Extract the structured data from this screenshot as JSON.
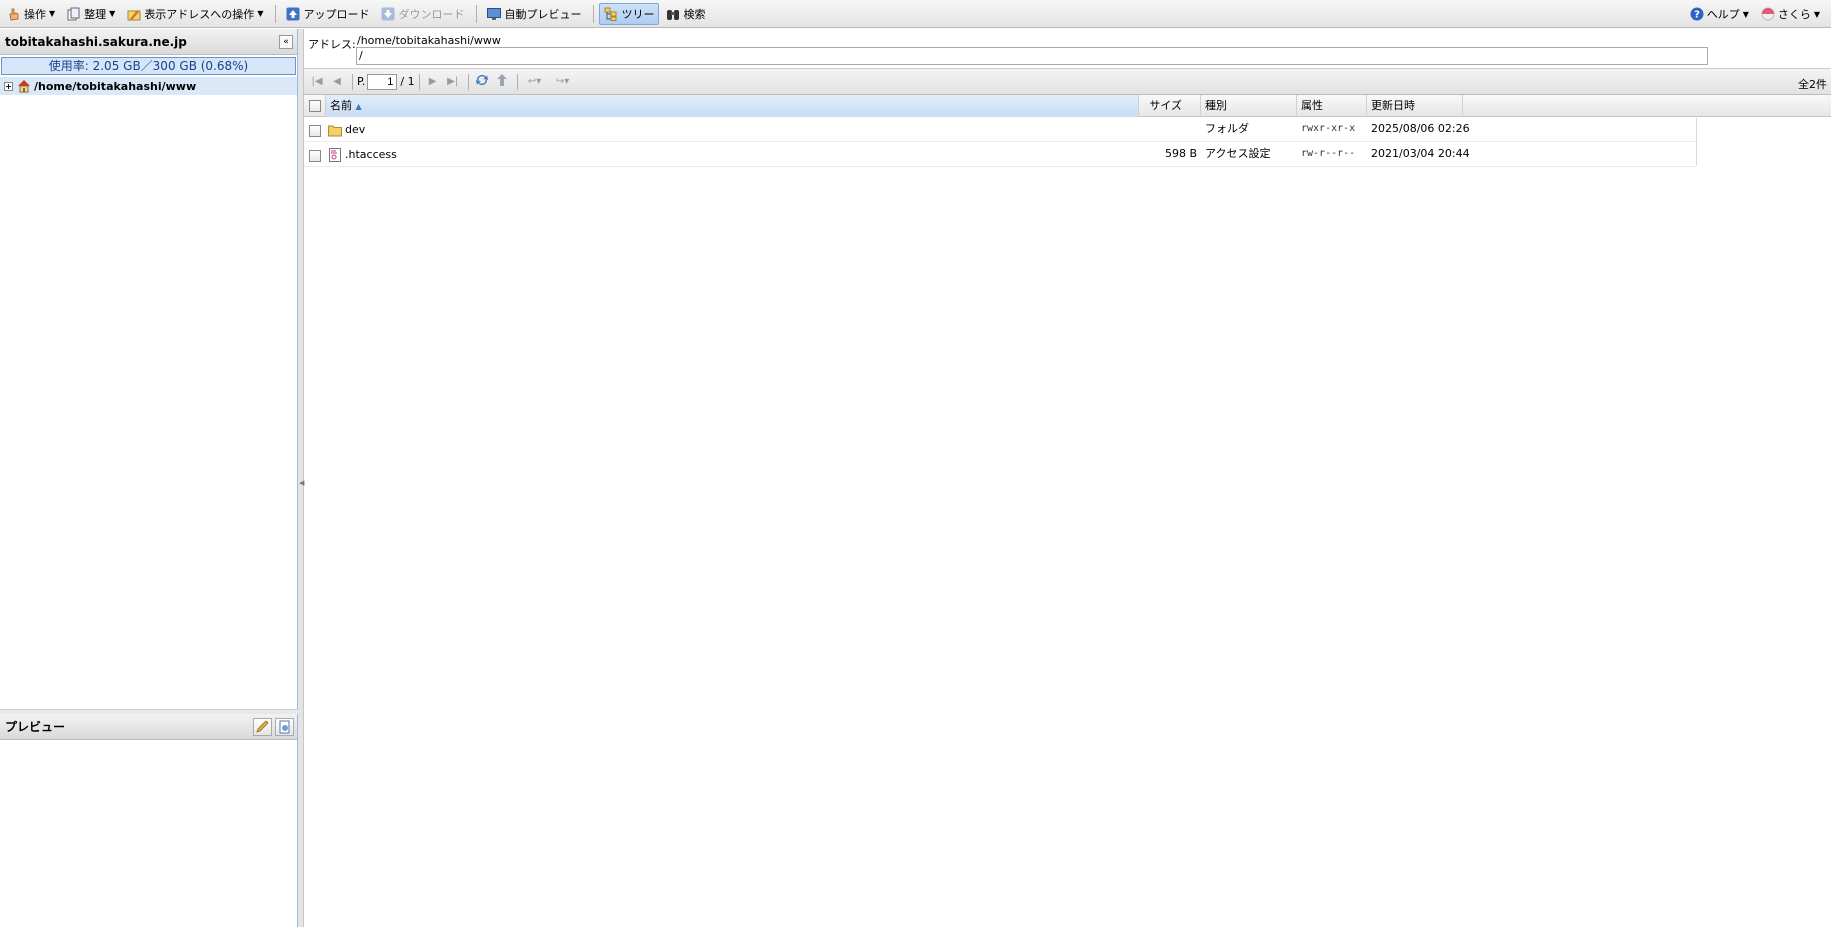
{
  "toolbar": {
    "operation": "操作",
    "organize": "整理",
    "address_ops": "表示アドレスへの操作",
    "upload": "アップロード",
    "download": "ダウンロード",
    "auto_preview": "自動プレビュー",
    "tree": "ツリー",
    "search": "検索",
    "help": "ヘルプ",
    "user": "さくら"
  },
  "left": {
    "domain": "tobitakahashi.sakura.ne.jp",
    "usage": "使用率: 2.05 GB／300 GB (0.68%)",
    "tree_root": "/home/tobitakahashi/www"
  },
  "preview": {
    "title": "プレビュー"
  },
  "address": {
    "label": "アドレス:",
    "path": "/home/tobitakahashi/www",
    "input_value": "/"
  },
  "pager": {
    "page_prefix": "P.",
    "page": "1",
    "page_total": "/ 1",
    "total": "全2件"
  },
  "grid": {
    "columns": {
      "name": "名前",
      "size": "サイズ",
      "type": "種別",
      "attr": "属性",
      "modified": "更新日時"
    },
    "rows": [
      {
        "name": "dev",
        "size": "",
        "type": "フォルダ",
        "attr": "rwxr-xr-x",
        "modified": "2025/08/06 02:26",
        "icon": "folder-icon"
      },
      {
        "name": ".htaccess",
        "size": "598 B",
        "type": "アクセス設定",
        "attr": "rw-r--r--",
        "modified": "2021/03/04 20:44",
        "icon": "file-icon"
      }
    ]
  }
}
